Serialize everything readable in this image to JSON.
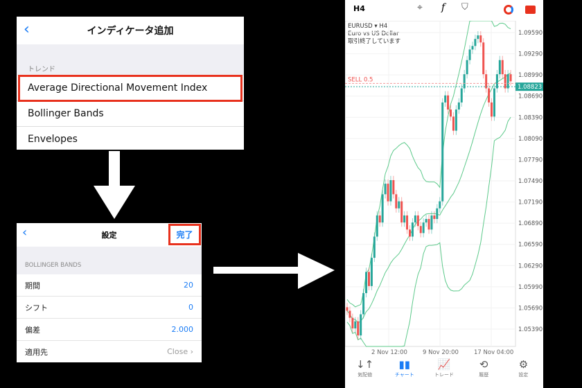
{
  "panel1": {
    "back": "‹",
    "title": "インディケータ追加",
    "section": "トレンド",
    "items": [
      "Average Directional Movement Index",
      "Bollinger Bands",
      "Envelopes"
    ],
    "highlighted": "Average Directional Movement Index"
  },
  "panel2": {
    "back": "‹",
    "title": "設定",
    "done": "完了",
    "section": "BOLLINGER BANDS",
    "rows": [
      {
        "label": "期間",
        "value": "20"
      },
      {
        "label": "シフト",
        "value": "0"
      },
      {
        "label": "偏差",
        "value": "2.000"
      },
      {
        "label": "適用先",
        "value": "Close ›"
      }
    ]
  },
  "phone": {
    "timeframe": "H4",
    "toolbar_icons": [
      "crosshair-icon",
      "function-icon",
      "objects-icon",
      "clock-icon",
      "account-icon"
    ],
    "symbol": "EURUSD ▾ H4",
    "description": "Euro vs US Dollar",
    "status": "取引終了しています",
    "sell_line": "SELL 0.5",
    "current_price": "1.08823",
    "price_labels": [
      "1.09590",
      "1.09290",
      "1.08990",
      "1.08690",
      "1.08390",
      "1.08090",
      "1.07790",
      "1.07490",
      "1.07190",
      "1.06890",
      "1.06590",
      "1.06290",
      "1.05990",
      "1.05690",
      "1.05390"
    ],
    "time_labels": [
      "2 Nov 12:00",
      "9 Nov 20:00",
      "17 Nov 04:00"
    ],
    "nav": [
      {
        "label": "気配値",
        "icon": "↓↑"
      },
      {
        "label": "チャート",
        "icon": "▮▮",
        "active": true
      },
      {
        "label": "トレード",
        "icon": "📈"
      },
      {
        "label": "履歴",
        "icon": "⟲"
      },
      {
        "label": "設定",
        "icon": "⚙"
      }
    ],
    "colors": {
      "up": "#26a69a",
      "down": "#ef5350",
      "band": "#5cc98a",
      "highlight": "#e8311d",
      "accent": "#1a7cf5"
    }
  },
  "chart_data": {
    "type": "candlestick",
    "indicator": "Bollinger Bands (20, 0, 2.000, Close)",
    "closes": [
      1.0565,
      1.0555,
      1.054,
      1.055,
      1.053,
      1.056,
      1.059,
      1.062,
      1.06,
      1.064,
      1.067,
      1.07,
      1.069,
      1.073,
      1.0745,
      1.072,
      1.075,
      1.073,
      1.071,
      1.072,
      1.069,
      1.07,
      1.068,
      1.067,
      1.069,
      1.07,
      1.0685,
      1.0675,
      1.069,
      1.0695,
      1.068,
      1.07,
      1.0695,
      1.071,
      1.072,
      1.086,
      1.087,
      1.085,
      1.084,
      1.082,
      1.085,
      1.086,
      1.088,
      1.09,
      1.092,
      1.0935,
      1.094,
      1.095,
      1.0955,
      1.0945,
      1.09,
      1.088,
      1.086,
      1.084,
      1.088,
      1.09,
      1.092,
      1.09,
      1.088,
      1.09,
      1.089
    ],
    "ylim": [
      1.0525,
      1.0985
    ]
  }
}
